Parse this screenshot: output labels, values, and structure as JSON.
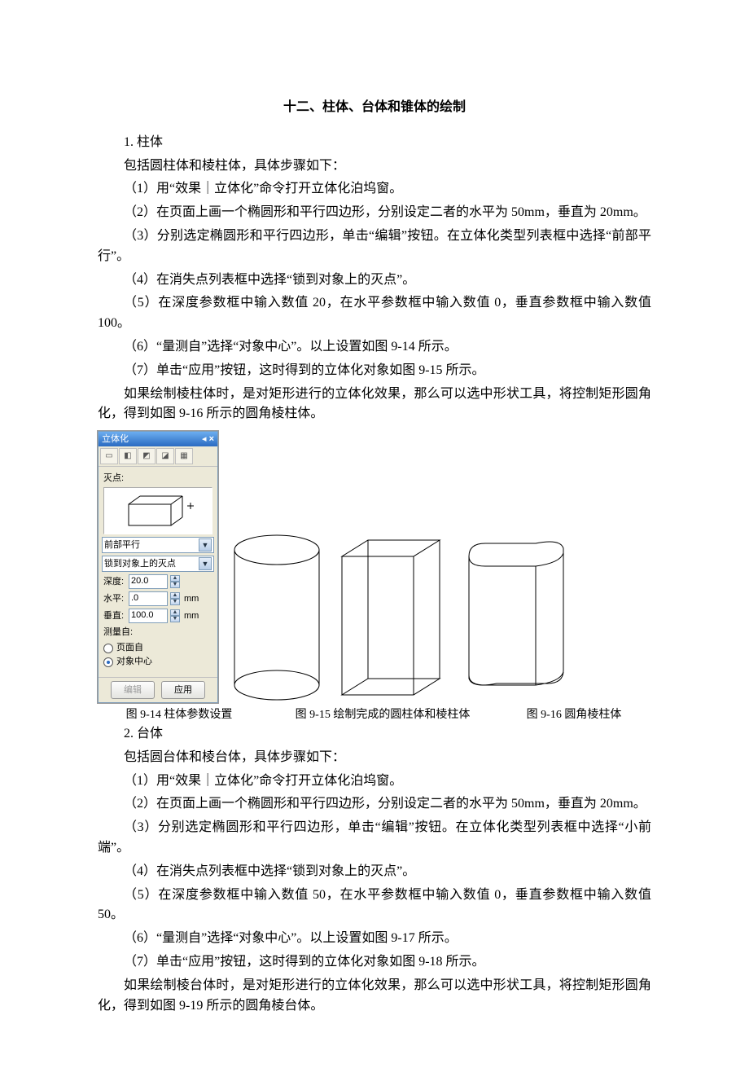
{
  "title": "十二、柱体、台体和锥体的绘制",
  "sec1": {
    "heading": "1. 柱体",
    "intro": "包括圆柱体和棱柱体，具体步骤如下：",
    "steps": [
      "（1）用“效果｜立体化”命令打开立体化泊坞窗。",
      "（2）在页面上画一个椭圆形和平行四边形，分别设定二者的水平为 50mm，垂直为 20mm。",
      "（3）分别选定椭圆形和平行四边形，单击“编辑”按钮。在立体化类型列表框中选择“前部平行”。",
      "（4）在消失点列表框中选择“锁到对象上的灭点”。",
      "（5）在深度参数框中输入数值 20，在水平参数框中输入数值 0，垂直参数框中输入数值 100。",
      "（6）“量测自”选择“对象中心”。以上设置如图 9-14 所示。",
      "（7）单击“应用”按钮，这时得到的立体化对象如图 9-15 所示。"
    ],
    "tail": "如果绘制棱柱体时，是对矩形进行的立体化效果，那么可以选中形状工具，将控制矩形圆角化，得到如图 9-16 所示的圆角棱柱体。"
  },
  "palette": {
    "title": "立体化",
    "sect_label": "灭点:",
    "type_select": "前部平行",
    "vp_select": "锁到对象上的灭点",
    "depth_label": "深度:",
    "depth_val": "20.0",
    "h_label": "水平:",
    "h_val": ".0",
    "h_unit": "mm",
    "v_label": "垂直:",
    "v_val": "100.0",
    "v_unit": "mm",
    "measure_label": "测量自:",
    "radio1": "页面自",
    "radio2": "对象中心",
    "btn_edit": "编辑",
    "btn_apply": "应用"
  },
  "captions": {
    "a": "图 9-14 柱体参数设置",
    "b": "图 9-15 绘制完成的圆柱体和棱柱体",
    "c": "图 9-16 圆角棱柱体"
  },
  "sec2": {
    "heading": "2. 台体",
    "intro": "包括圆台体和棱台体，具体步骤如下：",
    "steps": [
      "（1）用“效果｜立体化”命令打开立体化泊坞窗。",
      "（2）在页面上画一个椭圆形和平行四边形，分别设定二者的水平为 50mm，垂直为 20mm。",
      "（3）分别选定椭圆形和平行四边形，单击“编辑”按钮。在立体化类型列表框中选择“小前端”。",
      "（4）在消失点列表框中选择“锁到对象上的灭点”。",
      "（5）在深度参数框中输入数值 50，在水平参数框中输入数值 0，垂直参数框中输入数值 50。",
      "（6）“量测自”选择“对象中心”。以上设置如图 9-17 所示。",
      "（7）单击“应用”按钮，这时得到的立体化对象如图 9-18 所示。"
    ],
    "tail": "如果绘制棱台体时，是对矩形进行的立体化效果，那么可以选中形状工具，将控制矩形圆角化，得到如图 9-19 所示的圆角棱台体。"
  }
}
